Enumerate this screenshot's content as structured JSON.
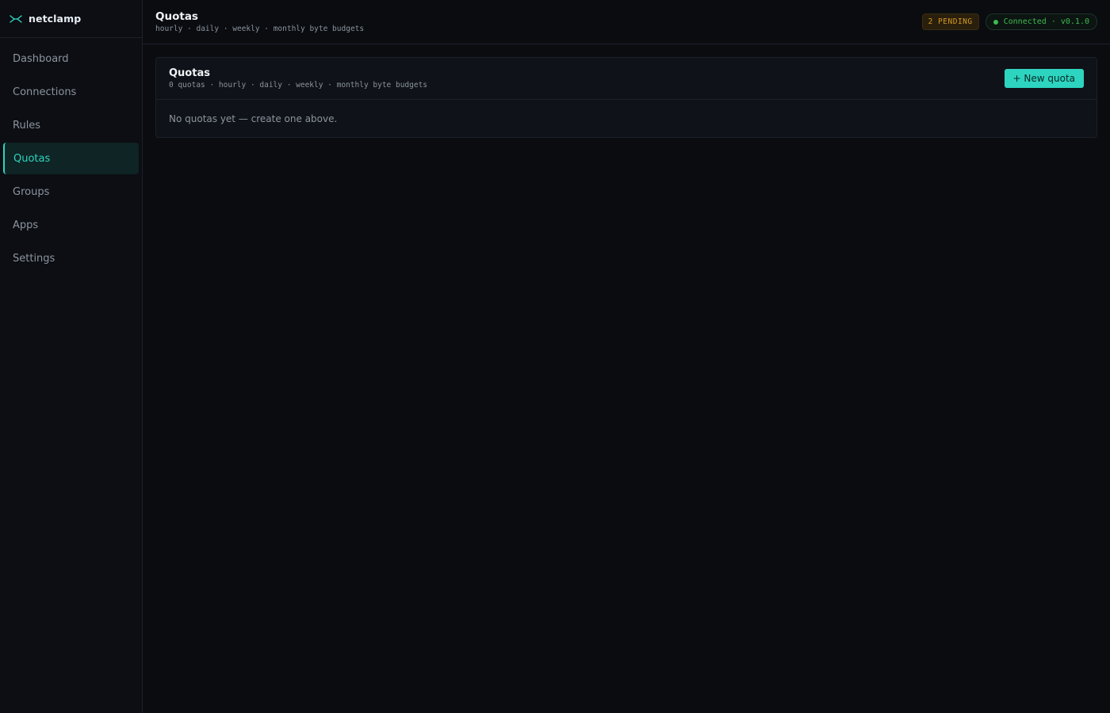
{
  "brand": {
    "name": "netclamp",
    "icon": "netclamp-logo-icon"
  },
  "colors": {
    "accent": "#2dd4bf",
    "pending": "#d29922",
    "connected": "#3fb950"
  },
  "sidebar": {
    "items": [
      {
        "label": "Dashboard"
      },
      {
        "label": "Connections"
      },
      {
        "label": "Rules"
      },
      {
        "label": "Quotas",
        "active": true
      },
      {
        "label": "Groups"
      },
      {
        "label": "Apps"
      },
      {
        "label": "Settings"
      }
    ]
  },
  "header": {
    "title": "Quotas",
    "subtitle": "hourly · daily · weekly · monthly byte budgets",
    "pending_badge": "2 PENDING",
    "status": "Connected · v0.1.0"
  },
  "card": {
    "title": "Quotas",
    "subtitle": "0 quotas · hourly · daily · weekly · monthly byte budgets",
    "new_button": "+ New quota",
    "empty_message": "No quotas yet — create one above."
  }
}
